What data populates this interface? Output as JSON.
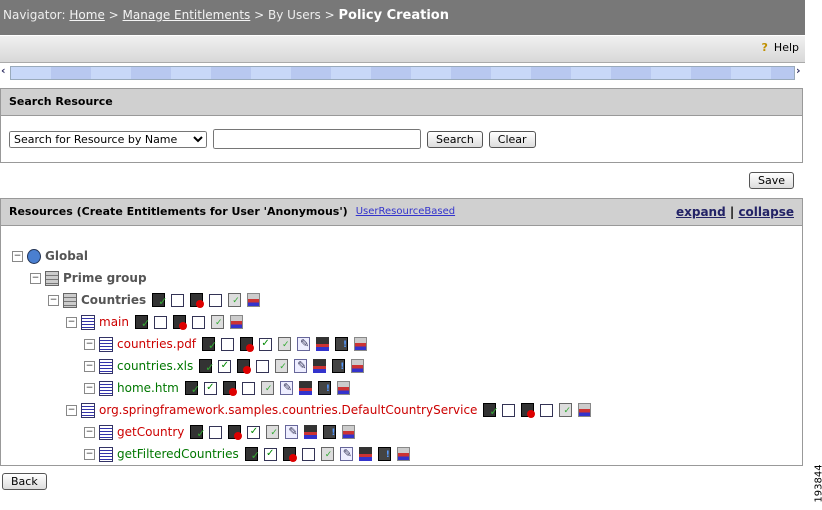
{
  "nav": {
    "prefix": "Navigator:",
    "home": "Home",
    "manage": "Manage Entitlements",
    "byusers": "By Users",
    "current": "Policy Creation",
    "sep": ">"
  },
  "toolbar": {
    "help": "Help"
  },
  "search": {
    "title": "Search Resource",
    "select_value": "Search for Resource by Name",
    "input_value": "",
    "search_label": "Search",
    "clear_label": "Clear"
  },
  "save_label": "Save",
  "resources": {
    "title": "Resources (Create Entitlements for User 'Anonymous')",
    "link": "UserResourceBased",
    "expand": "expand",
    "sep": "|",
    "collapse": "collapse"
  },
  "colors": {
    "red": "#cc0000",
    "green": "#007700",
    "gray": "#555555"
  },
  "tree": [
    {
      "name": "Global",
      "level": 0,
      "icon": "globe",
      "color": "gray",
      "bold": true
    },
    {
      "name": "Prime group",
      "level": 1,
      "icon": "grp",
      "color": "gray",
      "bold": true
    },
    {
      "name": "Countries",
      "level": 2,
      "icon": "grp",
      "color": "gray",
      "bold": true,
      "grant": false,
      "deny": false,
      "actions": [
        "rule",
        "list"
      ]
    },
    {
      "name": "main",
      "level": 3,
      "icon": "doc",
      "color": "red",
      "grant": false,
      "deny": false,
      "actions": [
        "rule",
        "list"
      ]
    },
    {
      "name": "countries.pdf",
      "level": 4,
      "icon": "doc",
      "color": "red",
      "grant": false,
      "deny": true,
      "actions": [
        "rule",
        "edit",
        "role",
        "info",
        "list"
      ]
    },
    {
      "name": "countries.xls",
      "level": 4,
      "icon": "doc",
      "color": "green",
      "grant": true,
      "deny": false,
      "actions": [
        "rule",
        "edit",
        "role",
        "info",
        "list"
      ]
    },
    {
      "name": "home.htm",
      "level": 4,
      "icon": "doc",
      "color": "green",
      "grant": true,
      "deny": false,
      "actions": [
        "rule",
        "edit",
        "role",
        "info",
        "list"
      ]
    },
    {
      "name": "org.springframework.samples.countries.DefaultCountryService",
      "level": 3,
      "icon": "doc",
      "color": "red",
      "grant": false,
      "deny": false,
      "actions": [
        "rule",
        "list"
      ]
    },
    {
      "name": "getCountry",
      "level": 4,
      "icon": "doc",
      "color": "red",
      "grant": false,
      "deny": true,
      "actions": [
        "rule",
        "edit",
        "role",
        "info",
        "list"
      ]
    },
    {
      "name": "getFilteredCountries",
      "level": 4,
      "icon": "doc",
      "color": "green",
      "grant": true,
      "deny": false,
      "actions": [
        "rule",
        "edit",
        "role",
        "info",
        "list"
      ]
    }
  ],
  "back_label": "Back",
  "figure_id": "193844"
}
